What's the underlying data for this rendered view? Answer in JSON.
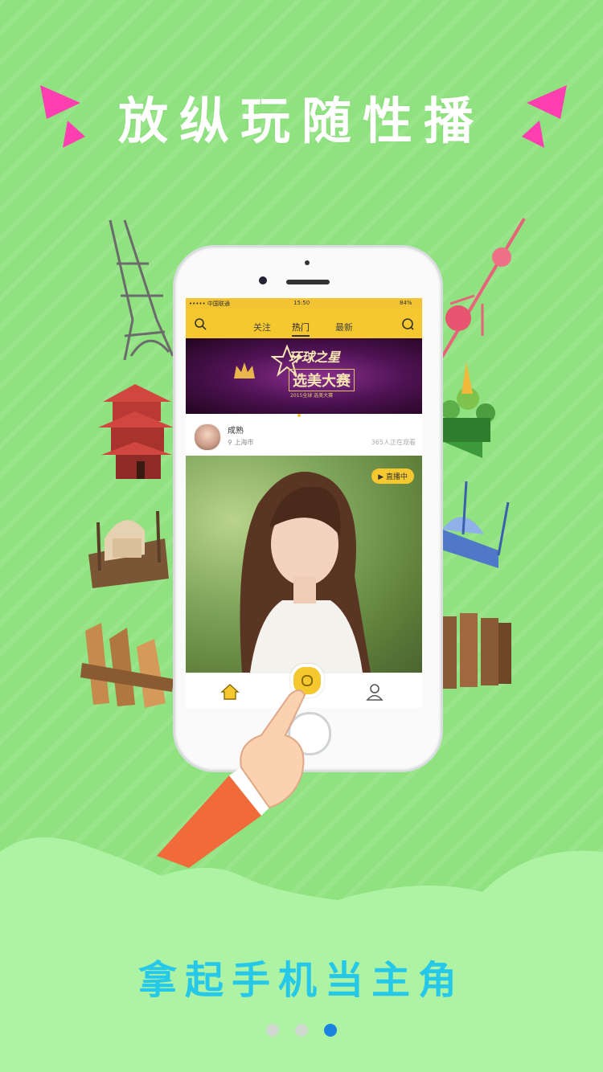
{
  "headline": "放纵玩随性播",
  "tagline": "拿起手机当主角",
  "page_dots": {
    "count": 3,
    "active_index": 2
  },
  "colors": {
    "background": "#8fe27f",
    "accent_pink": "#ff3fb0",
    "tagline": "#25c8e8",
    "app_yellow": "#f6c82f",
    "active_dot": "#1a83e0"
  },
  "phone_screen": {
    "status_bar": {
      "carrier": "••••• 中国联通",
      "time": "15:50",
      "battery": "84%"
    },
    "tabs": [
      {
        "label": "关注",
        "active": false
      },
      {
        "label": "热门",
        "active": true
      },
      {
        "label": "最新",
        "active": false
      }
    ],
    "banner": {
      "title1": "环球之星",
      "title2": "选美大赛",
      "subtitle": "2015全球  选美大赛",
      "dots": 2,
      "active_dot": 1
    },
    "feed_item": {
      "user_name": "成熟",
      "location": "上海市",
      "viewers": "365人正在观看",
      "live_badge": "直播中"
    },
    "bottom_nav": [
      "home-icon",
      "live-record-icon",
      "profile-icon"
    ]
  }
}
